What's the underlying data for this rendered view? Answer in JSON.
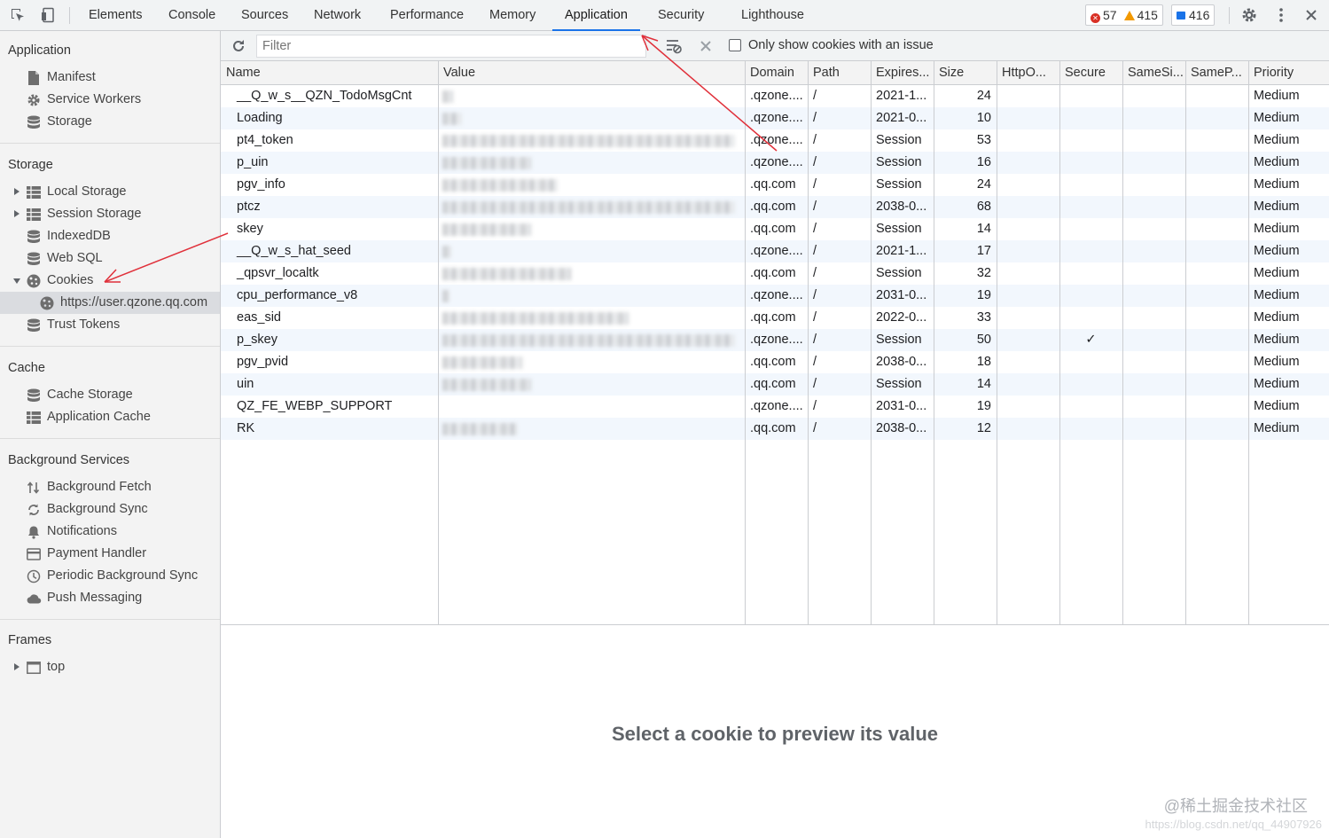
{
  "toolbar": {
    "tabs": [
      "Elements",
      "Console",
      "Sources",
      "Network",
      "Performance",
      "Memory",
      "Application",
      "Security",
      "Lighthouse"
    ],
    "active_tab": "Application",
    "errors": "57",
    "warnings": "415",
    "messages": "416"
  },
  "sidebar": {
    "application": {
      "title": "Application",
      "items": [
        "Manifest",
        "Service Workers",
        "Storage"
      ]
    },
    "storage": {
      "title": "Storage",
      "items": [
        "Local Storage",
        "Session Storage",
        "IndexedDB",
        "Web SQL",
        "Cookies"
      ],
      "cookie_child": "https://user.qzone.qq.com",
      "trust_tokens": "Trust Tokens"
    },
    "cache": {
      "title": "Cache",
      "items": [
        "Cache Storage",
        "Application Cache"
      ]
    },
    "background": {
      "title": "Background Services",
      "items": [
        "Background Fetch",
        "Background Sync",
        "Notifications",
        "Payment Handler",
        "Periodic Background Sync",
        "Push Messaging"
      ]
    },
    "frames": {
      "title": "Frames",
      "items": [
        "top"
      ]
    }
  },
  "filter": {
    "placeholder": "Filter",
    "checkbox_label": "Only show cookies with an issue"
  },
  "table": {
    "columns": [
      "Name",
      "Value",
      "Domain",
      "Path",
      "Expires...",
      "Size",
      "HttpO...",
      "Secure",
      "SameSi...",
      "SameP...",
      "Priority"
    ],
    "rows": [
      {
        "name": "__Q_w_s__QZN_TodoMsgCnt",
        "domain": ".qzone....",
        "path": "/",
        "expires": "2021-1...",
        "size": "24",
        "secure": "",
        "priority": "Medium"
      },
      {
        "name": "Loading",
        "domain": ".qzone....",
        "path": "/",
        "expires": "2021-0...",
        "size": "10",
        "secure": "",
        "priority": "Medium"
      },
      {
        "name": "pt4_token",
        "domain": ".qzone....",
        "path": "/",
        "expires": "Session",
        "size": "53",
        "secure": "",
        "priority": "Medium"
      },
      {
        "name": "p_uin",
        "domain": ".qzone....",
        "path": "/",
        "expires": "Session",
        "size": "16",
        "secure": "",
        "priority": "Medium"
      },
      {
        "name": "pgv_info",
        "domain": ".qq.com",
        "path": "/",
        "expires": "Session",
        "size": "24",
        "secure": "",
        "priority": "Medium"
      },
      {
        "name": "ptcz",
        "domain": ".qq.com",
        "path": "/",
        "expires": "2038-0...",
        "size": "68",
        "secure": "",
        "priority": "Medium"
      },
      {
        "name": "skey",
        "domain": ".qq.com",
        "path": "/",
        "expires": "Session",
        "size": "14",
        "secure": "",
        "priority": "Medium"
      },
      {
        "name": "__Q_w_s_hat_seed",
        "domain": ".qzone....",
        "path": "/",
        "expires": "2021-1...",
        "size": "17",
        "secure": "",
        "priority": "Medium"
      },
      {
        "name": "_qpsvr_localtk",
        "domain": ".qq.com",
        "path": "/",
        "expires": "Session",
        "size": "32",
        "secure": "",
        "priority": "Medium"
      },
      {
        "name": "cpu_performance_v8",
        "domain": ".qzone....",
        "path": "/",
        "expires": "2031-0...",
        "size": "19",
        "secure": "",
        "priority": "Medium"
      },
      {
        "name": "eas_sid",
        "domain": ".qq.com",
        "path": "/",
        "expires": "2022-0...",
        "size": "33",
        "secure": "",
        "priority": "Medium"
      },
      {
        "name": "p_skey",
        "domain": ".qzone....",
        "path": "/",
        "expires": "Session",
        "size": "50",
        "secure": "✓",
        "priority": "Medium"
      },
      {
        "name": "pgv_pvid",
        "domain": ".qq.com",
        "path": "/",
        "expires": "2038-0...",
        "size": "18",
        "secure": "",
        "priority": "Medium"
      },
      {
        "name": "uin",
        "domain": ".qq.com",
        "path": "/",
        "expires": "Session",
        "size": "14",
        "secure": "",
        "priority": "Medium"
      },
      {
        "name": "QZ_FE_WEBP_SUPPORT",
        "domain": ".qzone....",
        "path": "/",
        "expires": "2031-0...",
        "size": "19",
        "secure": "",
        "priority": "Medium"
      },
      {
        "name": "RK",
        "domain": ".qq.com",
        "path": "/",
        "expires": "2038-0...",
        "size": "12",
        "secure": "",
        "priority": "Medium"
      }
    ]
  },
  "preview": {
    "message": "Select a cookie to preview its value"
  },
  "watermark": {
    "text": "@稀土掘金技术社区",
    "url": "https://blog.csdn.net/qq_44907926"
  },
  "colors": {
    "accent": "#1a73e8",
    "error": "#d93025",
    "warning": "#f29900",
    "annotation_arrow": "#e0303a"
  }
}
